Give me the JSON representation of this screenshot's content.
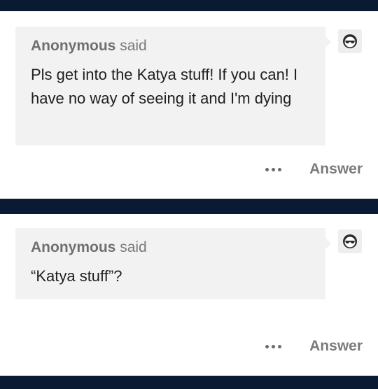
{
  "posts": [
    {
      "asker_name": "Anonymous",
      "asker_verb": "said",
      "question": "Pls get into the Katya stuff! If you can! I have no way of seeing it and I'm dying",
      "avatar_icon": "sunglasses-face-icon",
      "more_icon": "more-dots-icon",
      "answer_label": "Answer"
    },
    {
      "asker_name": "Anonymous",
      "asker_verb": "said",
      "question": "“Katya stuff”?",
      "avatar_icon": "sunglasses-face-icon",
      "more_icon": "more-dots-icon",
      "answer_label": "Answer"
    }
  ],
  "colors": {
    "band": "#0b1a33",
    "bubble": "#f2f2f2",
    "muted_text": "#7a7a7a",
    "body_text": "#1e1e1e"
  }
}
